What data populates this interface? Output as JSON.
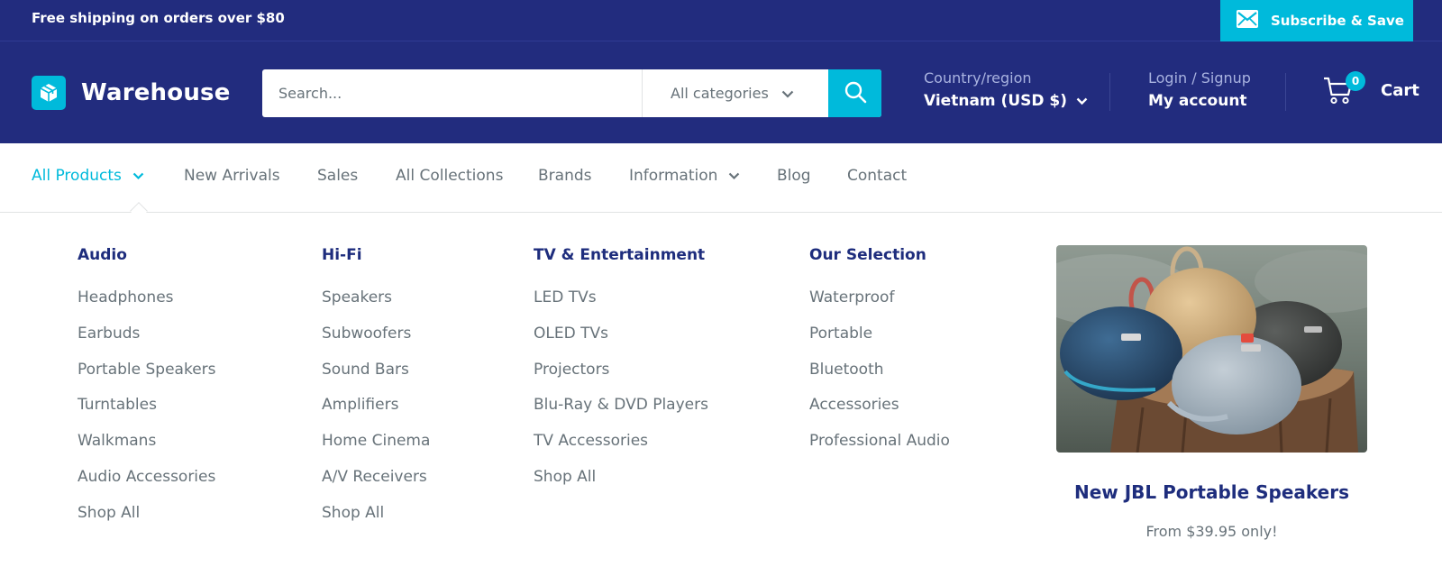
{
  "announcement": {
    "text": "Free shipping on orders over $80",
    "subscribe_label": "Subscribe & Save"
  },
  "header": {
    "logo_text": "Warehouse",
    "search": {
      "placeholder": "Search...",
      "category": "All categories"
    },
    "country": {
      "label": "Country/region",
      "value": "Vietnam (USD $)"
    },
    "account": {
      "label": "Login / Signup",
      "value": "My account"
    },
    "cart": {
      "count": "0",
      "label": "Cart"
    }
  },
  "nav": {
    "items": [
      {
        "label": "All Products",
        "has_dropdown": true,
        "active": true
      },
      {
        "label": "New Arrivals"
      },
      {
        "label": "Sales"
      },
      {
        "label": "All Collections"
      },
      {
        "label": "Brands"
      },
      {
        "label": "Information",
        "has_dropdown": true
      },
      {
        "label": "Blog"
      },
      {
        "label": "Contact"
      }
    ]
  },
  "mega_menu": {
    "columns": [
      {
        "title": "Audio",
        "links": [
          "Headphones",
          "Earbuds",
          "Portable Speakers",
          "Turntables",
          "Walkmans",
          "Audio Accessories",
          "Shop All"
        ]
      },
      {
        "title": "Hi-Fi",
        "links": [
          "Speakers",
          "Subwoofers",
          "Sound Bars",
          "Amplifiers",
          "Home Cinema",
          "A/V Receivers",
          "Shop All"
        ]
      },
      {
        "title": "TV & Entertainment",
        "links": [
          "LED TVs",
          "OLED TVs",
          "Projectors",
          "Blu-Ray & DVD Players",
          "TV Accessories",
          "Shop All"
        ]
      },
      {
        "title": "Our Selection",
        "links": [
          "Waterproof",
          "Portable",
          "Bluetooth",
          "Accessories",
          "Professional Audio"
        ]
      }
    ],
    "promo": {
      "title": "New JBL Portable Speakers",
      "subtitle": "From $39.95 only!"
    }
  },
  "colors": {
    "header_bg": "#222c7e",
    "accent": "#00badb",
    "heading": "#1e2d7d",
    "text": "#677279"
  }
}
